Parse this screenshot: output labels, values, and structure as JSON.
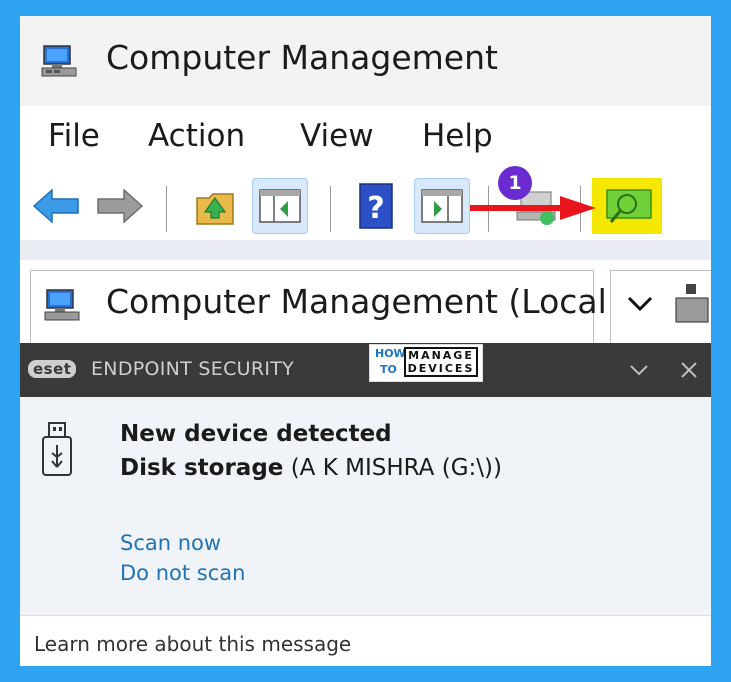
{
  "window": {
    "title": "Computer Management",
    "app_icon": "computer-management-icon"
  },
  "menu": [
    "File",
    "Action",
    "View",
    "Help"
  ],
  "toolbar": {
    "icons": [
      "back-arrow-icon",
      "forward-arrow-icon",
      "up-folder-icon",
      "show-hide-tree-icon",
      "help-icon",
      "show-hide-action-pane-icon",
      "properties-icon",
      "connect-computer-icon"
    ],
    "callout_number": "1",
    "highlight_color": "#f5e800",
    "arrow_color": "#e8161c"
  },
  "tree": {
    "root_label": "Computer Management (Local",
    "root_icon": "computer-management-icon",
    "right_pane_icon": "chevron-down-icon"
  },
  "watermark": {
    "line1": "HOW",
    "line2": "TO",
    "brand_top": "MANAGE",
    "brand_bottom": "DEVICES"
  },
  "eset_notification": {
    "logo": "eset",
    "product": "ENDPOINT SECURITY",
    "title": "New device detected",
    "device_type": "Disk storage",
    "device_detail": "(A K MISHRA (G:\\))",
    "actions": [
      "Scan now",
      "Do not scan"
    ],
    "footer": "Learn more about this message",
    "icon": "usb-drive-icon"
  }
}
